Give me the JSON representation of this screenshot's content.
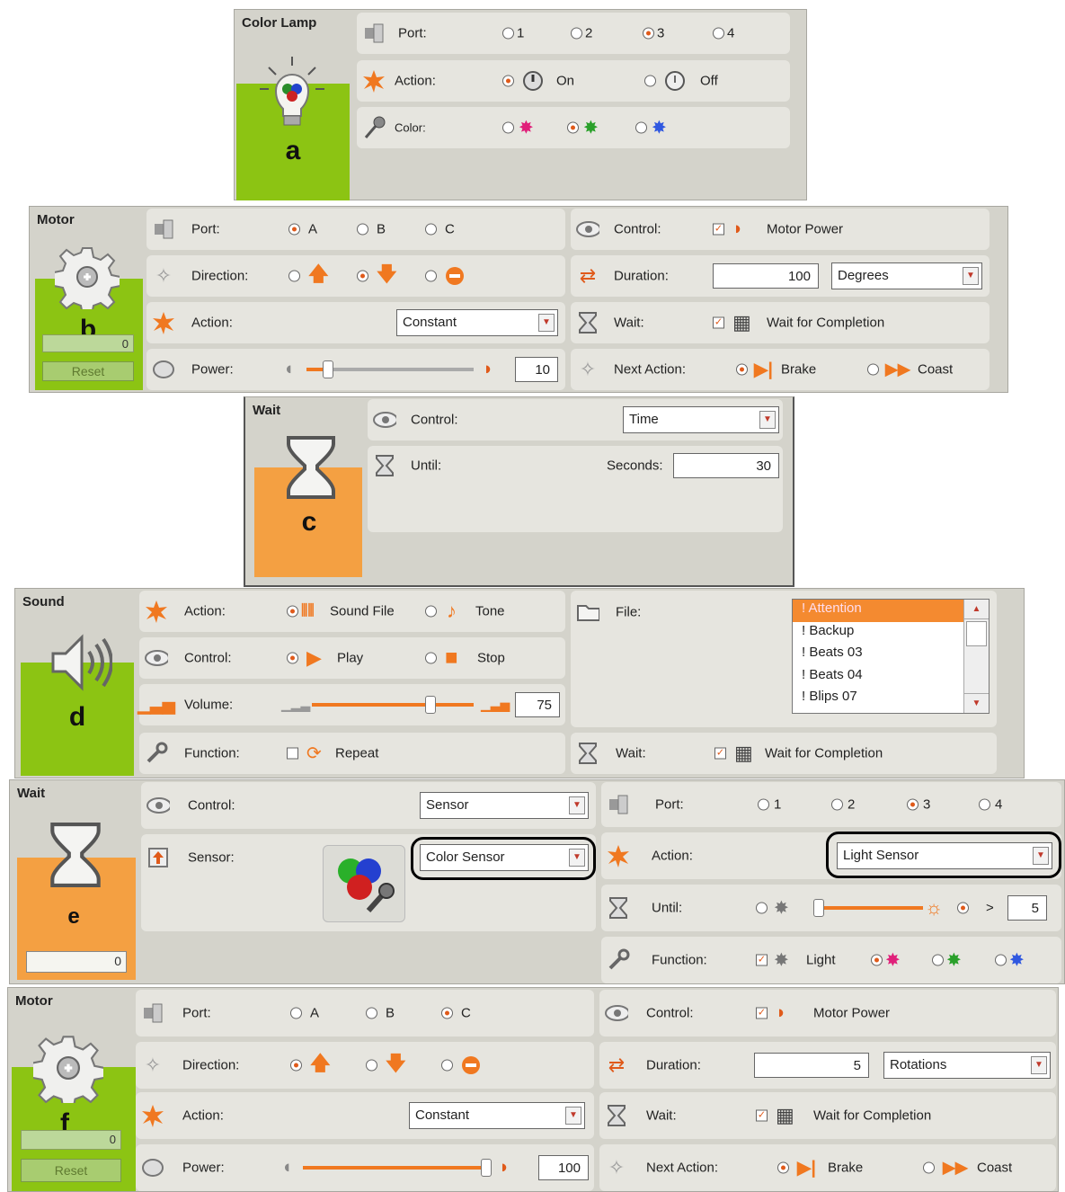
{
  "a": {
    "title": "Color Lamp",
    "letter": "a",
    "port_label": "Port:",
    "port_options": [
      "1",
      "2",
      "3",
      "4"
    ],
    "action_label": "Action:",
    "action_on": "On",
    "action_off": "Off",
    "color_label": "Color:"
  },
  "b": {
    "title": "Motor",
    "letter": "b",
    "counter": "0",
    "reset": "Reset",
    "port_label": "Port:",
    "port_options": [
      "A",
      "B",
      "C"
    ],
    "direction_label": "Direction:",
    "action_label": "Action:",
    "action_value": "Constant",
    "power_label": "Power:",
    "power_value": "10",
    "control_label": "Control:",
    "control_value": "Motor Power",
    "duration_label": "Duration:",
    "duration_value": "100",
    "duration_unit": "Degrees",
    "wait_label": "Wait:",
    "wait_value": "Wait for Completion",
    "next_label": "Next Action:",
    "brake": "Brake",
    "coast": "Coast"
  },
  "c": {
    "title": "Wait",
    "letter": "c",
    "control_label": "Control:",
    "control_value": "Time",
    "until_label": "Until:",
    "seconds_label": "Seconds:",
    "seconds_value": "30"
  },
  "d": {
    "title": "Sound",
    "letter": "d",
    "action_label": "Action:",
    "sound_file": "Sound File",
    "tone": "Tone",
    "control_label": "Control:",
    "play": "Play",
    "stop": "Stop",
    "volume_label": "Volume:",
    "volume_value": "75",
    "function_label": "Function:",
    "repeat": "Repeat",
    "file_label": "File:",
    "files": [
      "! Attention",
      "! Backup",
      "! Beats 03",
      "! Beats 04",
      "! Blips 07"
    ],
    "wait_label": "Wait:",
    "wait_value": "Wait for Completion"
  },
  "e": {
    "title": "Wait",
    "letter": "e",
    "counter": "0",
    "control_label": "Control:",
    "control_value": "Sensor",
    "sensor_label": "Sensor:",
    "sensor_value": "Color Sensor",
    "port_label": "Port:",
    "port_options": [
      "1",
      "2",
      "3",
      "4"
    ],
    "action_label": "Action:",
    "action_value": "Light Sensor",
    "until_label": "Until:",
    "compare": ">",
    "until_value": "5",
    "function_label": "Function:",
    "light": "Light"
  },
  "f": {
    "title": "Motor",
    "letter": "f",
    "counter": "0",
    "reset": "Reset",
    "port_label": "Port:",
    "port_options": [
      "A",
      "B",
      "C"
    ],
    "direction_label": "Direction:",
    "action_label": "Action:",
    "action_value": "Constant",
    "power_label": "Power:",
    "power_value": "100",
    "control_label": "Control:",
    "control_value": "Motor Power",
    "duration_label": "Duration:",
    "duration_value": "5",
    "duration_unit": "Rotations",
    "wait_label": "Wait:",
    "wait_value": "Wait for Completion",
    "next_label": "Next Action:",
    "brake": "Brake",
    "coast": "Coast"
  },
  "colors": {
    "orange": "#f07820",
    "green": "#8cc413",
    "block_orange": "#f4a042",
    "panel": "#d4d3cb",
    "row": "#e6e5df"
  }
}
